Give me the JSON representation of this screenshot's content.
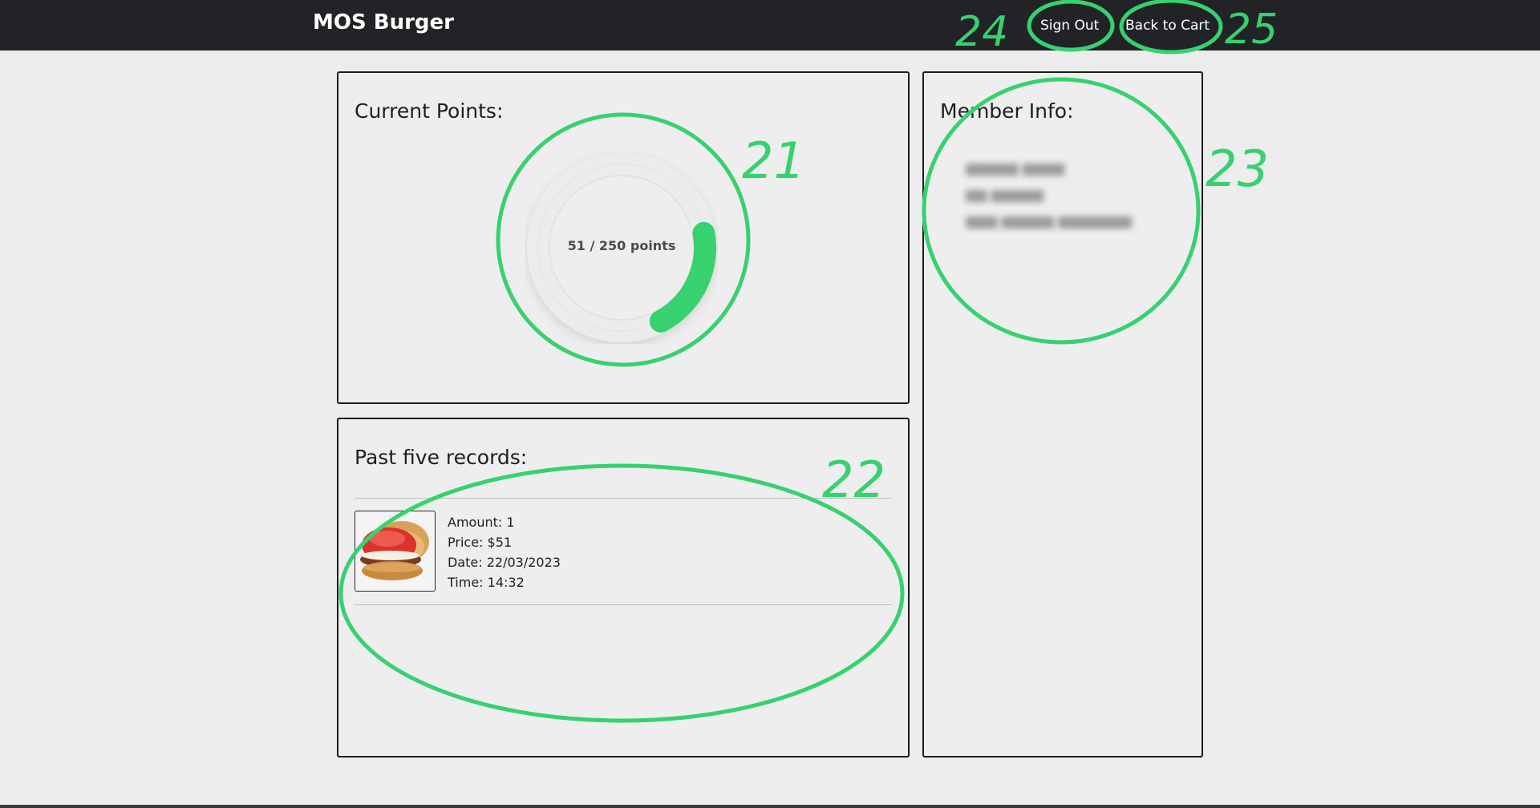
{
  "header": {
    "brand": "MOS Burger",
    "sign_out_label": "Sign Out",
    "back_to_cart_label": "Back to Cart"
  },
  "points": {
    "title": "Current Points:",
    "current": 51,
    "max": 250,
    "label": "51 / 250 points",
    "accent_color": "#37d16f"
  },
  "records": {
    "title": "Past five records:",
    "items": [
      {
        "image_icon": "burger-image",
        "amount": "Amount: 1",
        "price": "Price: $51",
        "date": "Date: 22/03/2023",
        "time": "Time: 14:32"
      }
    ]
  },
  "member": {
    "title": "Member Info:"
  },
  "annotations": {
    "color": "#37d16f",
    "labels": [
      "21",
      "22",
      "23",
      "24",
      "25"
    ]
  }
}
